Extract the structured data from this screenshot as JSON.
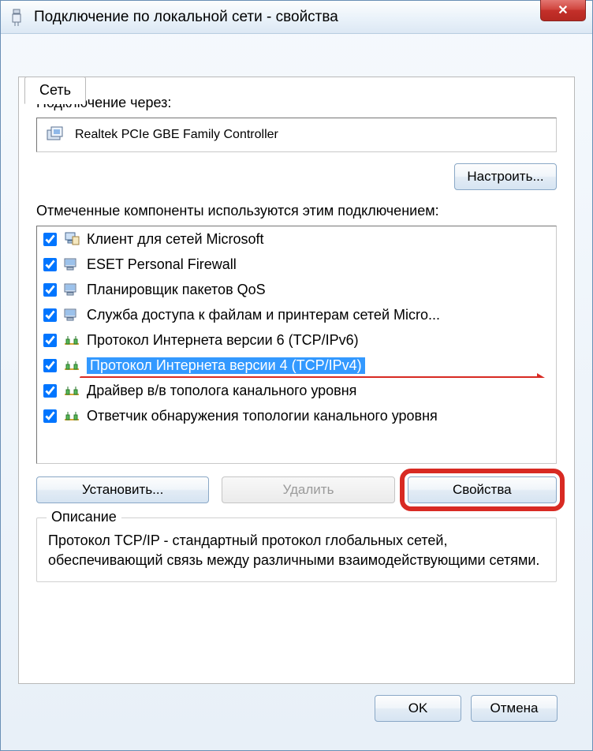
{
  "window": {
    "title": "Подключение по локальной сети - свойства",
    "close_glyph": "✕"
  },
  "tab": {
    "label": "Сеть"
  },
  "connect_using": {
    "label": "Подключение через:",
    "adapter": "Realtek PCIe GBE Family Controller"
  },
  "configure_btn": "Настроить...",
  "components": {
    "label": "Отмеченные компоненты используются этим подключением:",
    "items": [
      {
        "checked": true,
        "icon": "client",
        "text": "Клиент для сетей Microsoft"
      },
      {
        "checked": true,
        "icon": "service",
        "text": "ESET Personal Firewall"
      },
      {
        "checked": true,
        "icon": "service",
        "text": "Планировщик пакетов QoS"
      },
      {
        "checked": true,
        "icon": "service",
        "text": "Служба доступа к файлам и принтерам сетей Micro..."
      },
      {
        "checked": true,
        "icon": "protocol",
        "text": "Протокол Интернета версии 6 (TCP/IPv6)"
      },
      {
        "checked": true,
        "icon": "protocol",
        "text": "Протокол Интернета версии 4 (TCP/IPv4)",
        "selected": true
      },
      {
        "checked": true,
        "icon": "protocol",
        "text": "Драйвер в/в тополога канального уровня"
      },
      {
        "checked": true,
        "icon": "protocol",
        "text": "Ответчик обнаружения топологии канального уровня"
      }
    ]
  },
  "buttons": {
    "install": "Установить...",
    "uninstall": "Удалить",
    "properties": "Свойства"
  },
  "description": {
    "title": "Описание",
    "text": "Протокол TCP/IP - стандартный протокол глобальных сетей, обеспечивающий связь между различными взаимодействующими сетями."
  },
  "dialog": {
    "ok": "OK",
    "cancel": "Отмена"
  }
}
